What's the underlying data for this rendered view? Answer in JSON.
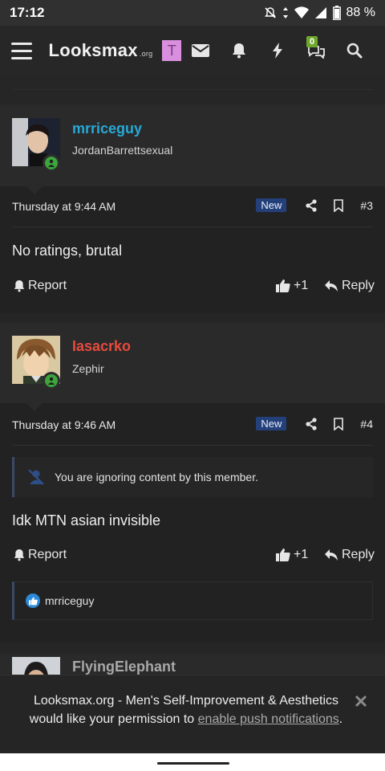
{
  "status_bar": {
    "time": "17:12",
    "battery": "88 %"
  },
  "header": {
    "logo_main": "Looksmax",
    "logo_suffix": ".org",
    "user_initial": "T",
    "conversations_badge": "0",
    "colors": {
      "bg": "#272727",
      "avatar_bg": "#d98fdd"
    }
  },
  "posts": [
    {
      "username": "mrriceguy",
      "username_color": "#27a9d6",
      "user_title": "JordanBarrettsexual",
      "timestamp": "Thursday at 9:44 AM",
      "new_label": "New",
      "post_number": "#3",
      "content": "No ratings, brutal",
      "actions": {
        "report": "Report",
        "like": "+1",
        "reply": "Reply"
      }
    },
    {
      "username": "Iasacrko",
      "username_color": "#e84a3c",
      "user_title": "Zephir",
      "timestamp": "Thursday at 9:46 AM",
      "new_label": "New",
      "post_number": "#4",
      "ignored_notice": "You are ignoring content by this member.",
      "content": "Idk MTN asian invisible",
      "actions": {
        "report": "Report",
        "like": "+1",
        "reply": "Reply"
      },
      "reactions": {
        "users": "mrriceguy"
      }
    },
    {
      "username": "FlyingElephant",
      "username_color": "#a8a8a8"
    }
  ],
  "push_banner": {
    "text_prefix": "Looksmax.org - Men's Self-Improvement & Aesthetics would like your permission to ",
    "link_text": "enable push notifications",
    "text_suffix": "."
  }
}
